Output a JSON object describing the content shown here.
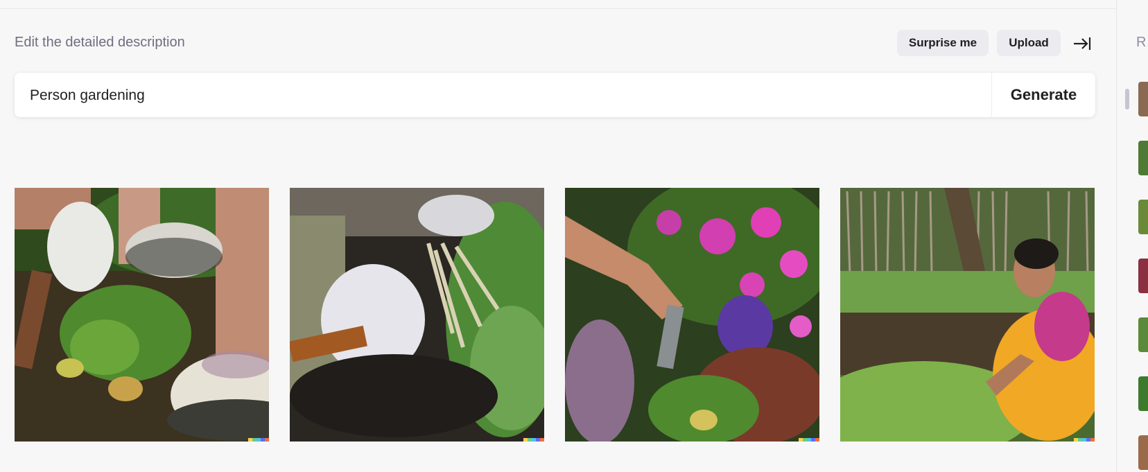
{
  "editor": {
    "label": "Edit the detailed description",
    "prompt_value": "Person gardening",
    "surprise_label": "Surprise me",
    "upload_label": "Upload",
    "generate_label": "Generate"
  },
  "images": [
    {
      "subject": "gloved hand with trowel, clogs, green plants"
    },
    {
      "subject": "white glove pulling weeds from dark soil"
    },
    {
      "subject": "hand with trowel among pink and purple flowers"
    },
    {
      "subject": "woman in yellow sari tending garden"
    }
  ],
  "watermark_colors": [
    "#fbd14b",
    "#67cc87",
    "#52c1e6",
    "#5b6ef7",
    "#f06e3a"
  ],
  "right_panel": {
    "label": "R"
  },
  "icons": {
    "collapse": "arrow-right-to-line-icon"
  }
}
